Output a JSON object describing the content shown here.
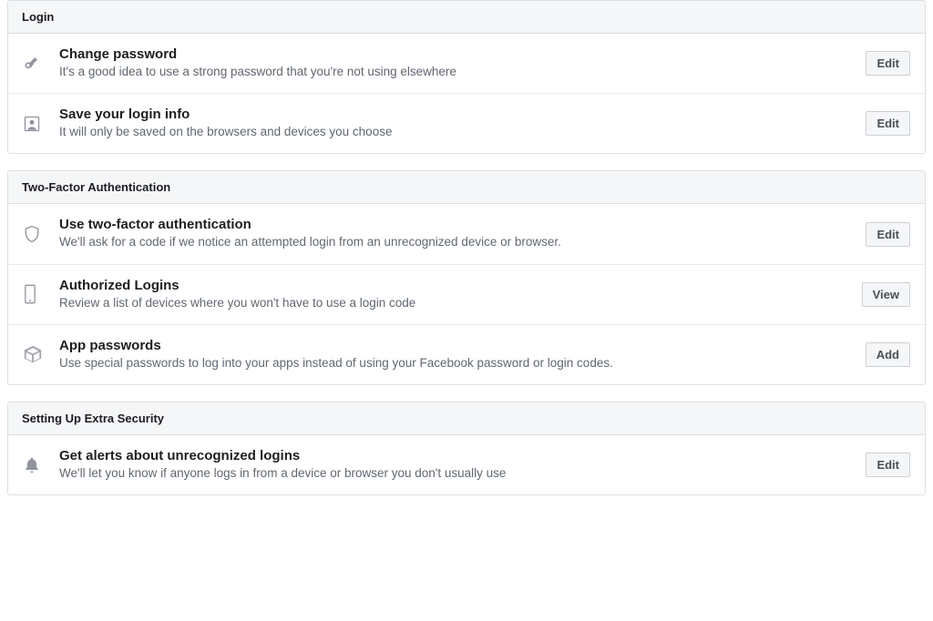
{
  "sections": [
    {
      "header": "Login",
      "rows": [
        {
          "title": "Change password",
          "desc": "It's a good idea to use a strong password that you're not using elsewhere",
          "button": "Edit",
          "icon": "key"
        },
        {
          "title": "Save your login info",
          "desc": "It will only be saved on the browsers and devices you choose",
          "button": "Edit",
          "icon": "profile"
        }
      ]
    },
    {
      "header": "Two-Factor Authentication",
      "rows": [
        {
          "title": "Use two-factor authentication",
          "desc": "We'll ask for a code if we notice an attempted login from an unrecognized device or browser.",
          "button": "Edit",
          "icon": "shield"
        },
        {
          "title": "Authorized Logins",
          "desc": "Review a list of devices where you won't have to use a login code",
          "button": "View",
          "icon": "phone"
        },
        {
          "title": "App passwords",
          "desc": "Use special passwords to log into your apps instead of using your Facebook password or login codes.",
          "button": "Add",
          "icon": "box"
        }
      ]
    },
    {
      "header": "Setting Up Extra Security",
      "rows": [
        {
          "title": "Get alerts about unrecognized logins",
          "desc": "We'll let you know if anyone logs in from a device or browser you don't usually use",
          "button": "Edit",
          "icon": "bell"
        }
      ]
    }
  ]
}
